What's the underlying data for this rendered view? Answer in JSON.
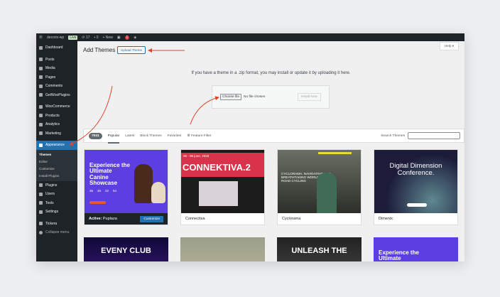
{
  "adminbar": {
    "site": "decorix-wp",
    "live": "Live",
    "updates": "17",
    "comments": "0",
    "new": "+ New",
    "notifications": "1"
  },
  "sidebar": {
    "items": [
      "Dashboard",
      "Posts",
      "Media",
      "Pages",
      "Comments",
      "GetWooPlugins",
      "WooCommerce",
      "Products",
      "Analytics",
      "Marketing",
      "Appearance"
    ],
    "sub": [
      "Themes",
      "Editor",
      "Customize",
      "Install Plugins"
    ],
    "items2": [
      "Plugins",
      "Users",
      "Tools",
      "Settings",
      "Tickera",
      "Collapse menu"
    ]
  },
  "page": {
    "title": "Add Themes",
    "upload": "Upload Theme",
    "help": "Help ▾",
    "hint": "If you have a theme in a .zip format, you may install or update it by uploading it here.",
    "choose": "Choose file",
    "nofile": "No file chosen",
    "install": "Install Now"
  },
  "filter": {
    "count": "7041",
    "tabs": [
      "Popular",
      "Latest",
      "Block Themes",
      "Favorites"
    ],
    "feature": "⚙ Feature Filter",
    "search_label": "Search Themes"
  },
  "themes": [
    {
      "name": "Puplaza",
      "active_label": "Active:",
      "customize": "Customize",
      "headline": "Experience the Ultimate Canine Showcase",
      "counters": [
        "35",
        "45",
        "22",
        "54"
      ],
      "color": "#5b3fe0"
    },
    {
      "name": "Connectiva",
      "headline": "CONNEKTIVA.2",
      "date": "05 - 06 june, 2026",
      "color": "#d8334a"
    },
    {
      "name": "Cyclorama",
      "headline": "CYCLORAMA: NAVIGATING THE BREATHTAKING WORLD OF ROAD CYCLING",
      "color": "#3a3d38"
    },
    {
      "name": "Dimenix",
      "headline": "Digital Dimension Conference.",
      "color": "#1c1b3a"
    }
  ],
  "row2": [
    {
      "headline": "EVENY CLUB",
      "color": "#1a1060"
    },
    {
      "headline": "",
      "color": "#8a8f7c"
    },
    {
      "headline": "UNLEASH THE",
      "color": "#2a2a2a"
    },
    {
      "headline": "Experience the Ultimate Canine",
      "color": "#5b3fe0"
    }
  ],
  "accent": "#2271b1"
}
